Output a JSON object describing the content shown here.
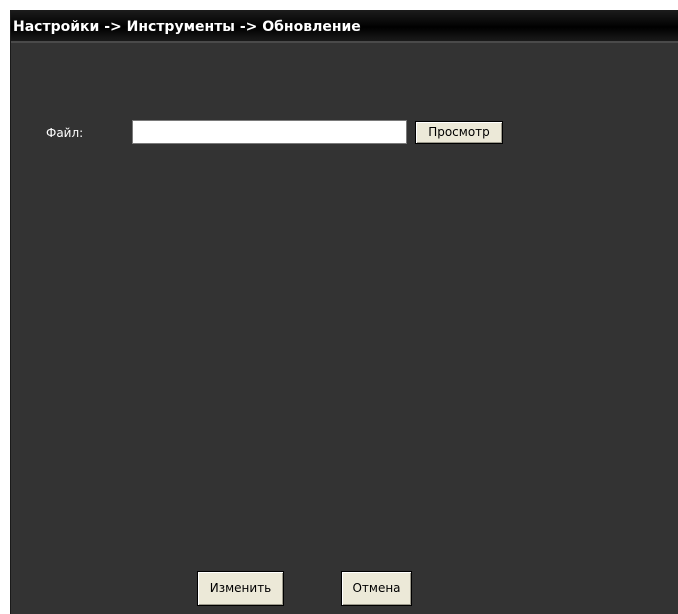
{
  "header": {
    "title": "Настройки -> Инструменты -> Обновление"
  },
  "form": {
    "file_label": "Файл:",
    "file_value": "",
    "browse_label": "Просмотр"
  },
  "actions": {
    "apply_label": "Изменить",
    "cancel_label": "Отмена"
  },
  "colors": {
    "panel_background": "#333333",
    "titlebar_background": "#000000",
    "title_text": "#ffffff",
    "button_face": "#ece9d8"
  }
}
